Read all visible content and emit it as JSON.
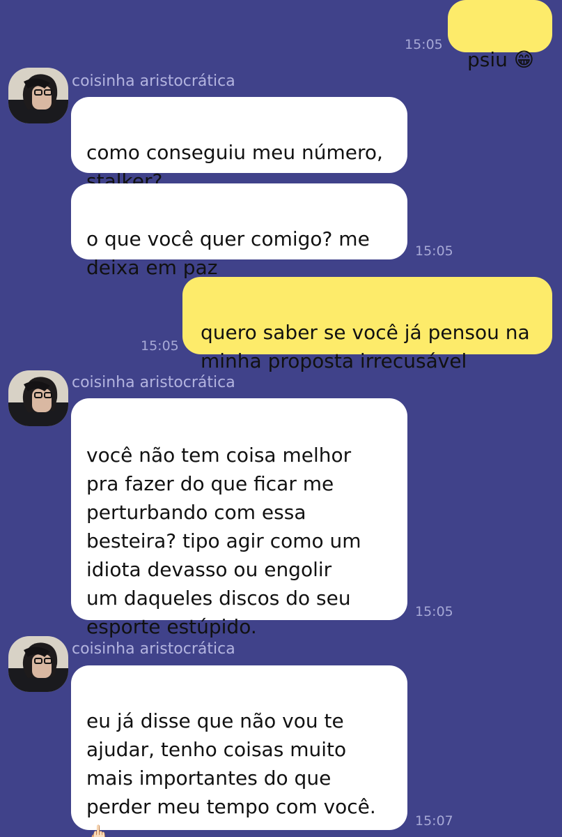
{
  "colors": {
    "background": "#40428a",
    "incoming_bubble": "#ffffff",
    "outgoing_bubble": "#fdeb6a",
    "sender_name": "#b3b4df",
    "timestamp": "#a7a9d6"
  },
  "contact": {
    "name": "coisinha aristocrática",
    "avatar": "profile-photo"
  },
  "messages": [
    {
      "direction": "out",
      "text": "psiu 😁",
      "time": "15:05"
    },
    {
      "direction": "in",
      "sender": "coisinha aristocrática",
      "text": "como conseguiu meu número,\nstalker?"
    },
    {
      "direction": "in",
      "text": "o que você quer comigo? me\ndeixa em paz",
      "time": "15:05"
    },
    {
      "direction": "out",
      "text": "quero saber se você já pensou na\nminha proposta irrecusável",
      "time": "15:05"
    },
    {
      "direction": "in",
      "sender": "coisinha aristocrática",
      "text": "você não tem coisa melhor\npra fazer do que ficar me\nperturbando com essa\nbesteira? tipo agir como um\nidiota devasso ou engolir\num daqueles discos do seu\nesporte estúpido.",
      "time": "15:05"
    },
    {
      "direction": "in",
      "sender": "coisinha aristocrática",
      "text": "eu já disse que não vou te\najudar, tenho coisas muito\nmais importantes do que\nperder meu tempo com você.\n🖕🏻",
      "time": "15:07"
    }
  ]
}
